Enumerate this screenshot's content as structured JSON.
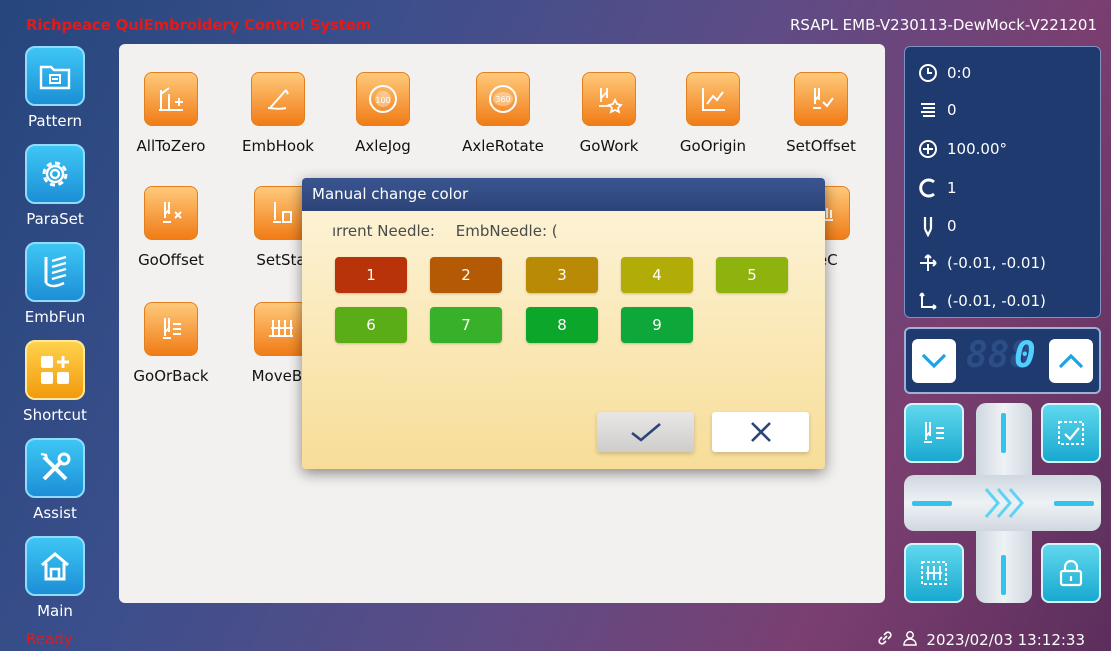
{
  "header": {
    "app_title": "Richpeace QuiEmbroidery Control System",
    "version": "RSAPL EMB-V230113-DewMock-V221201"
  },
  "sidebar": {
    "items": [
      {
        "label": "Pattern",
        "icon": "pattern-folder-icon"
      },
      {
        "label": "ParaSet",
        "icon": "gear-icon"
      },
      {
        "label": "EmbFun",
        "icon": "embroidery-needle-icon"
      },
      {
        "label": "Shortcut",
        "icon": "shortcut-grid-icon",
        "active": true
      },
      {
        "label": "Assist",
        "icon": "tools-icon"
      },
      {
        "label": "Main",
        "icon": "home-icon"
      }
    ]
  },
  "functions": [
    {
      "label": "AllToZero",
      "icon": "all-to-zero-icon"
    },
    {
      "label": "EmbHook",
      "icon": "emb-hook-icon"
    },
    {
      "label": "AxleJog",
      "icon": "axle-jog-icon"
    },
    {
      "label": "AxleRotate",
      "icon": "axle-rotate-icon"
    },
    {
      "label": "GoWork",
      "icon": "go-work-icon"
    },
    {
      "label": "GoOrigin",
      "icon": "go-origin-icon"
    },
    {
      "label": "SetOffset",
      "icon": "set-offset-icon"
    },
    {
      "label": "GoOffset",
      "icon": "go-offset-icon"
    },
    {
      "label": "SetSta",
      "icon": "set-start-icon"
    },
    {
      "label": "geC",
      "icon": "change-icon"
    },
    {
      "label": "GoOrBack",
      "icon": "go-or-back-icon"
    },
    {
      "label": "MoveBc",
      "icon": "move-back-icon"
    }
  ],
  "axle_jog_badge": "100",
  "axle_rotate_badge": "360",
  "modal": {
    "title": "Manual change color",
    "current_needle_label": "ırrent Needle:",
    "emb_needle_label": "EmbNeedle: (",
    "colors": [
      {
        "label": "1",
        "color": "#b8320a"
      },
      {
        "label": "2",
        "color": "#b45a04"
      },
      {
        "label": "3",
        "color": "#b88a06"
      },
      {
        "label": "4",
        "color": "#b1ac08"
      },
      {
        "label": "5",
        "color": "#8eb20e"
      },
      {
        "label": "6",
        "color": "#5aad16"
      },
      {
        "label": "7",
        "color": "#37b12a"
      },
      {
        "label": "8",
        "color": "#0ba62a"
      },
      {
        "label": "9",
        "color": "#0ea83a"
      }
    ],
    "confirm_icon": "checkmark-icon",
    "cancel_icon": "close-icon"
  },
  "info": {
    "time": "0:0",
    "stitches": "0",
    "angle": "100.00°",
    "color": "1",
    "needle": "0",
    "position": "(-0.01, -0.01)",
    "origin": "(-0.01, -0.01)"
  },
  "counter": {
    "value": "0",
    "ghost": "888"
  },
  "footer": {
    "status": "Ready",
    "datetime": "2023/02/03 13:12:33"
  },
  "colors": {
    "accent": "#2c4478",
    "orange": "#f39a0c",
    "cyan": "#34c3ef",
    "red": "#e21a1a"
  }
}
